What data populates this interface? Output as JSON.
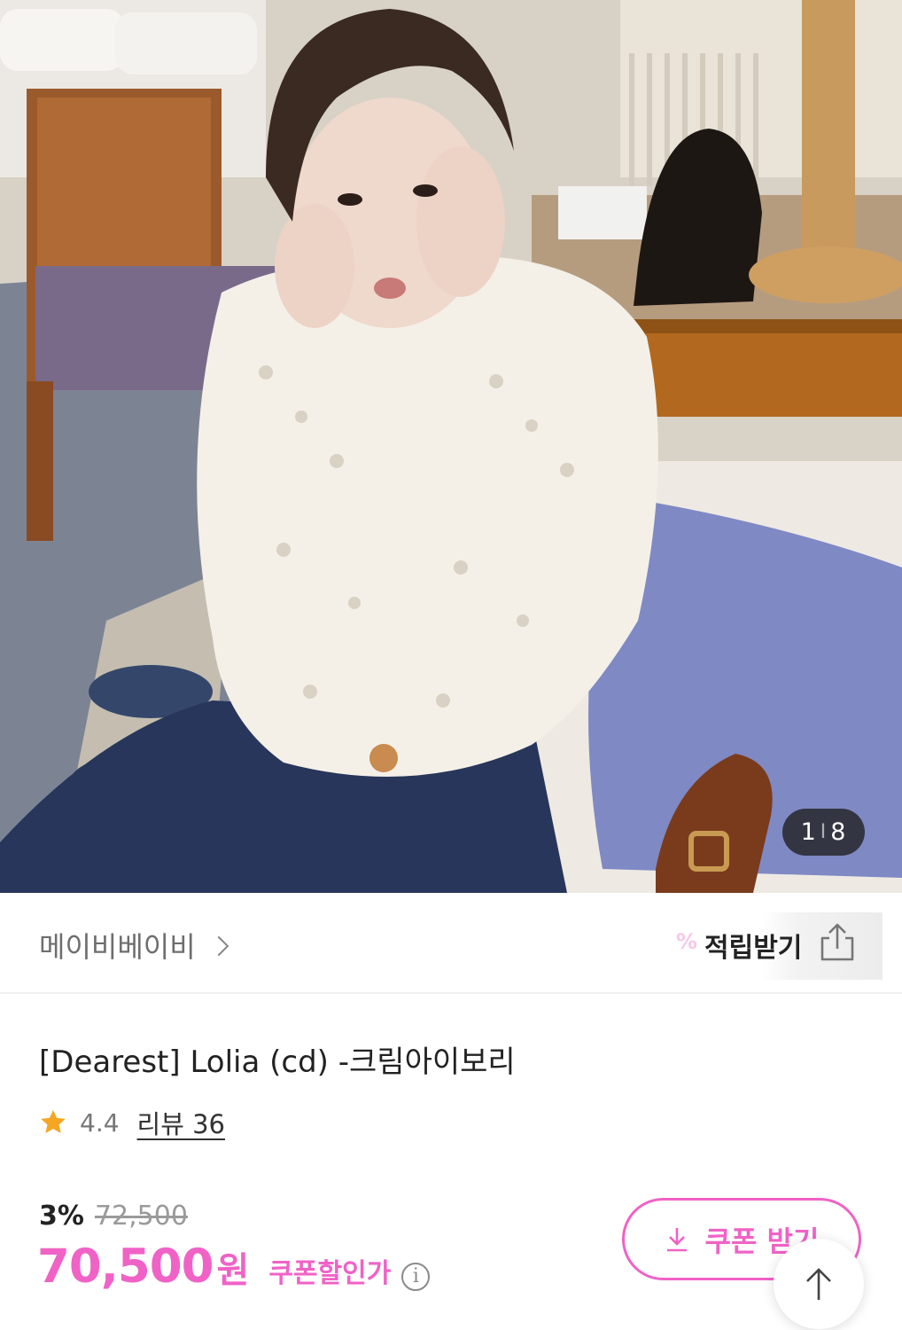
{
  "gallery": {
    "current": "1",
    "separator": "I",
    "total": "8"
  },
  "brand": {
    "name": "메이비베이비",
    "points_label": "적립받기",
    "points_icon": "%"
  },
  "product": {
    "title": "[Dearest] Lolia (cd) -크림아이보리",
    "rating": "4.4",
    "review_label": "리뷰 36"
  },
  "price": {
    "discount": "3%",
    "original": "72,500",
    "final": "70,500",
    "unit": "원",
    "coupon_price_label": "쿠폰할인가",
    "info_icon": "i"
  },
  "coupon_button": {
    "label": "쿠폰 받기"
  },
  "colors": {
    "accent": "#f062c6",
    "star": "#f5a623",
    "muted": "#9a9a9a"
  },
  "icons": [
    "download-icon",
    "share-icon",
    "star-icon",
    "info-icon",
    "chevron-right-icon",
    "arrow-up-icon"
  ]
}
